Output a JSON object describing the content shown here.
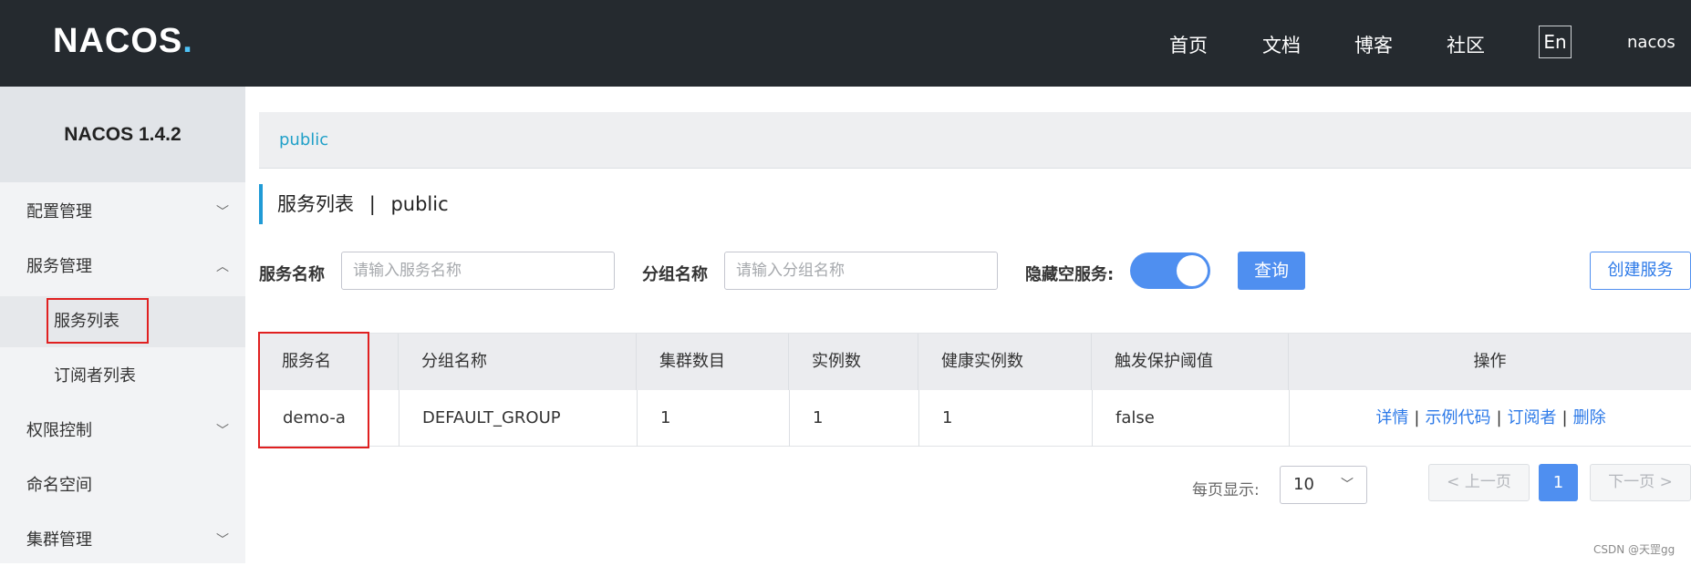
{
  "header": {
    "logo": "NACOS",
    "logo_dot": ".",
    "nav": [
      "首页",
      "文档",
      "博客",
      "社区"
    ],
    "lang": "En",
    "user": "nacos"
  },
  "sidebar": {
    "version": "NACOS 1.4.2",
    "items": [
      {
        "label": "配置管理",
        "chevron": "chevron-down-icon"
      },
      {
        "label": "服务管理",
        "chevron": "chevron-up-icon"
      },
      {
        "label": "服务列表"
      },
      {
        "label": "订阅者列表"
      },
      {
        "label": "权限控制",
        "chevron": "chevron-down-icon"
      },
      {
        "label": "命名空间"
      },
      {
        "label": "集群管理",
        "chevron": "chevron-down-icon"
      }
    ]
  },
  "namespace_bar": {
    "label": "public"
  },
  "page": {
    "title": "服务列表",
    "separator": "|",
    "namespace": "public"
  },
  "filters": {
    "service_name_label": "服务名称",
    "service_name_placeholder": "请输入服务名称",
    "group_name_label": "分组名称",
    "group_name_placeholder": "请输入分组名称",
    "hide_empty_label": "隐藏空服务:",
    "hide_empty_on": true,
    "query_label": "查询",
    "create_label": "创建服务"
  },
  "table": {
    "columns": [
      "服务名",
      "分组名称",
      "集群数目",
      "实例数",
      "健康实例数",
      "触发保护阈值",
      "操作"
    ],
    "rows": [
      {
        "service": "demo-a",
        "group": "DEFAULT_GROUP",
        "clusters": "1",
        "instances": "1",
        "healthy": "1",
        "threshold": "false",
        "ops": [
          "详情",
          "示例代码",
          "订阅者",
          "删除"
        ]
      }
    ]
  },
  "pager": {
    "per_page_label": "每页显示:",
    "per_page_value": "10",
    "prev_label": "< 上一页",
    "current_page": "1",
    "next_label": "下一页 >"
  },
  "watermark": "CSDN @天罡gg",
  "colors": {
    "accent": "#4f8ff0",
    "header_bg": "#252a2f",
    "highlight": "#e02020"
  }
}
